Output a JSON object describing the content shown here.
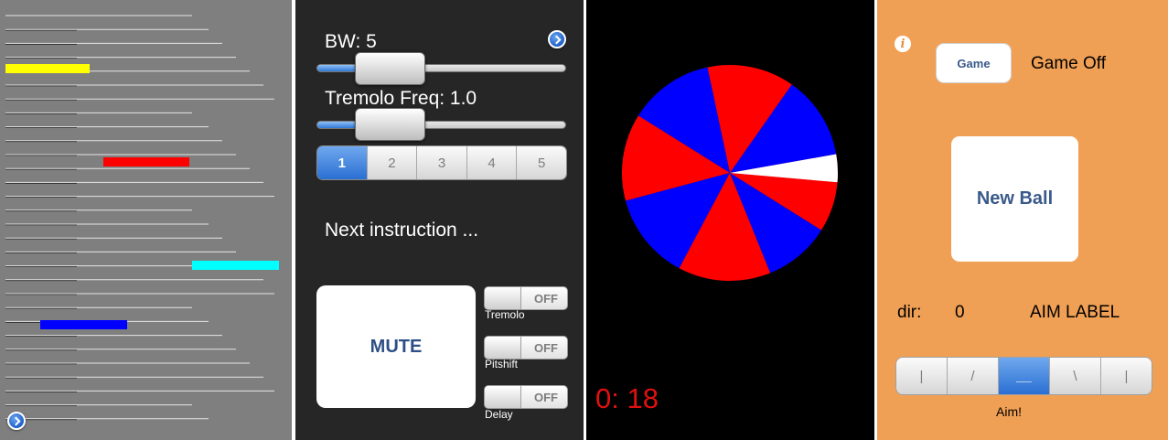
{
  "colors": {
    "lines_bg": "#7f7f7f",
    "controls_bg": "#262626",
    "wheel_bg": "#000000",
    "game_bg": "#f0a055",
    "bar_yellow": "#ffff00",
    "bar_red": "#ff0000",
    "bar_cyan": "#00ffff",
    "bar_blue": "#0000ff",
    "accent_blue": "#2a6fd2",
    "timer_red": "#e01010"
  },
  "lines_panel": {
    "info_icon": "chevron-right-circle-icon"
  },
  "controls": {
    "info_icon": "chevron-right-circle-icon",
    "bw_label": "BW: 5",
    "bw_value": 0.2,
    "tremolo_freq_label": "Tremolo Freq: 1.0",
    "tremolo_freq_value": 0.2,
    "segments": [
      "1",
      "2",
      "3",
      "4",
      "5"
    ],
    "selected_segment": "1",
    "next_instruction": "Next instruction ...",
    "mute_label": "MUTE",
    "toggles": [
      {
        "state": "OFF",
        "label": "Tremolo"
      },
      {
        "state": "OFF",
        "label": "Pitshift"
      },
      {
        "state": "OFF",
        "label": "Delay"
      }
    ]
  },
  "wheel": {
    "timer": "0: 18",
    "segment_colors": [
      "red",
      "blue",
      "red",
      "blue",
      "red",
      "blue",
      "red",
      "blue",
      "red",
      "white"
    ]
  },
  "game": {
    "info_icon": "info-icon",
    "game_button": "Game",
    "game_status": "Game Off",
    "new_ball_button": "New Ball",
    "dir_label": "dir:",
    "dir_value": "0",
    "aim_label": "AIM LABEL",
    "aim_segments": [
      "|",
      "/",
      "__",
      "\\",
      "|"
    ],
    "selected_aim": "__",
    "aim_caption": "Aim!"
  }
}
